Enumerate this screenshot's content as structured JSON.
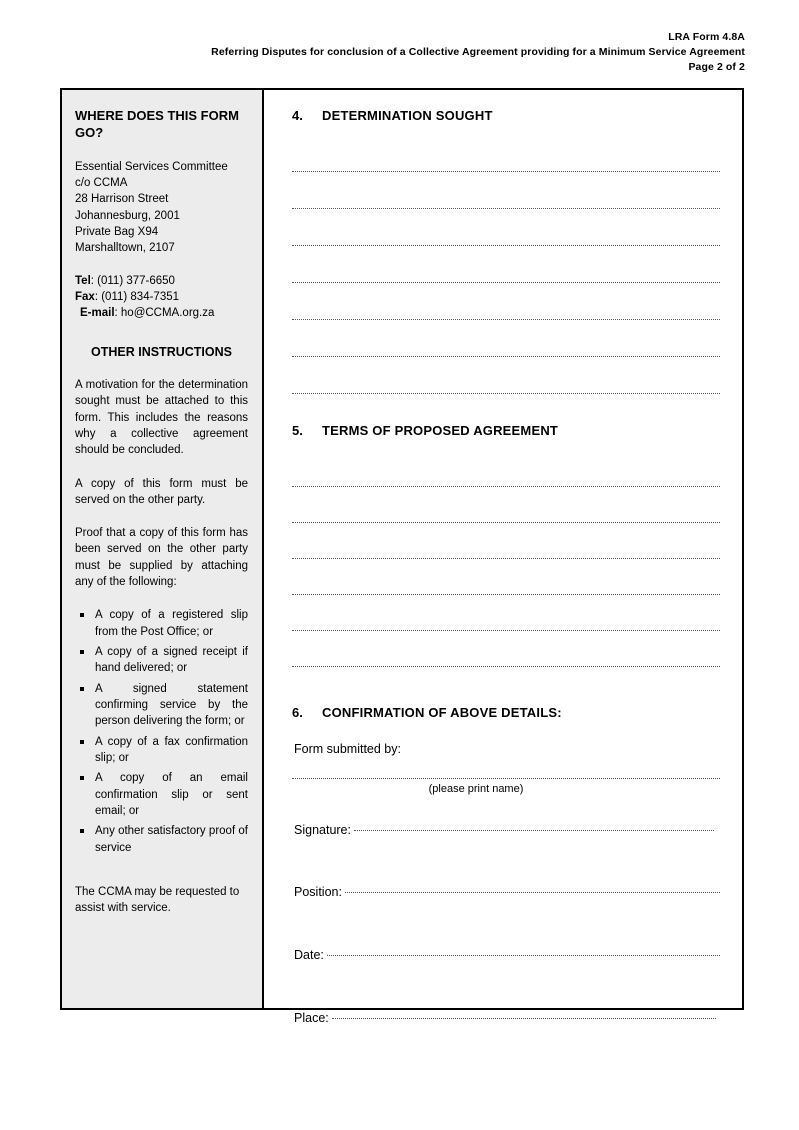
{
  "header": {
    "form_code": "LRA Form 4.8A",
    "subtitle": "Referring Disputes for conclusion of a Collective Agreement providing for a Minimum Service Agreement",
    "page_label": "Page 2 of 2"
  },
  "sidebar": {
    "panel_title": "WHERE DOES THIS FORM GO?",
    "address": [
      "Essential Services Committee",
      "c/o CCMA",
      "28 Harrison Street",
      "Johannesburg, 2001",
      "Private Bag X94",
      "Marshalltown, 2107"
    ],
    "contacts": [
      {
        "label": "Tel",
        "value": ": (011) 377-6650"
      },
      {
        "label": "Fax",
        "value": ": (011) 834-7351"
      },
      {
        "label": "E-mail",
        "value": ": ho@CCMA.org.za"
      }
    ],
    "other_instructions_title": "OTHER INSTRUCTIONS",
    "paragraphs": [
      "A motivation for the determination sought must be attached to this form.  This includes the reasons why a collective agreement should be concluded.",
      "A copy of this form must be served on the other party.",
      "Proof that a copy of this form has been served on the other party must be supplied by attaching any of the following:"
    ],
    "proof_items": [
      "A copy of a registered slip from the Post Office; or",
      "A copy of a signed receipt if hand delivered; or",
      "A signed statement confirming service by the person delivering the form; or",
      "A copy of a fax confirmation slip; or",
      "A copy of an email confirmation slip or sent email; or",
      "Any other satisfactory proof of service"
    ],
    "closing_note": "The CCMA may be requested to assist with service."
  },
  "main": {
    "section4": {
      "number": "4.",
      "title": "DETERMINATION SOUGHT",
      "line_count": 7
    },
    "section5": {
      "number": "5.",
      "title": "TERMS OF PROPOSED AGREEMENT",
      "line_count": 6
    },
    "section6": {
      "number": "6.",
      "title": "CONFIRMATION OF ABOVE DETAILS:",
      "submitted_by_label": "Form submitted by:",
      "print_name_caption": "(please print name)",
      "fields": [
        {
          "label": "Signature:",
          "value": ""
        },
        {
          "label": "Position:",
          "value": ""
        },
        {
          "label": "Date:",
          "value": ""
        },
        {
          "label": "Place:",
          "value": ""
        }
      ]
    }
  }
}
